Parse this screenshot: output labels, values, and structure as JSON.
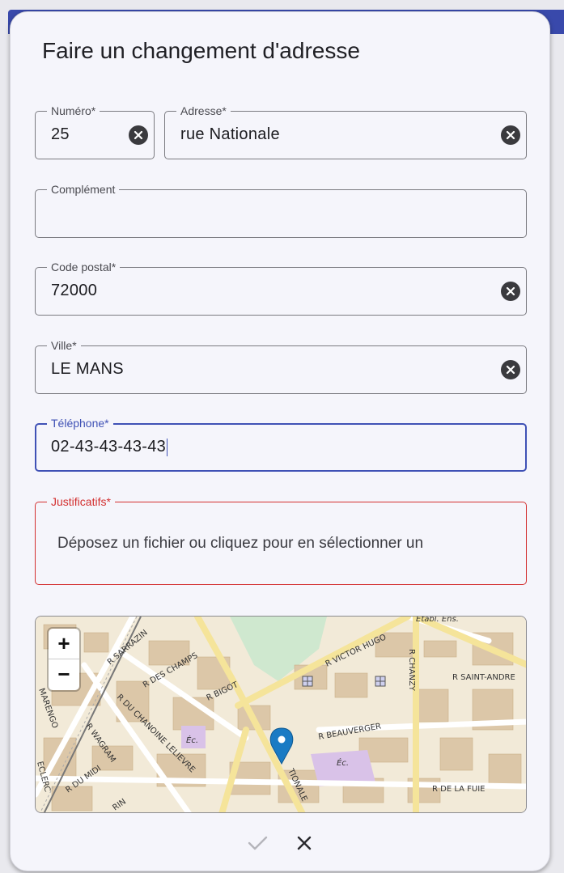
{
  "dialog": {
    "title": "Faire un changement d'adresse"
  },
  "form": {
    "numero": {
      "label": "Numéro*",
      "value": "25"
    },
    "adresse": {
      "label": "Adresse*",
      "value": "rue Nationale"
    },
    "complement": {
      "label": "Complément",
      "value": ""
    },
    "code_postal": {
      "label": "Code postal*",
      "value": "72000"
    },
    "ville": {
      "label": "Ville*",
      "value": "LE MANS"
    },
    "telephone": {
      "label": "Téléphone*",
      "value": "02-43-43-43-43"
    },
    "justificatifs": {
      "label": "Justificatifs*",
      "placeholder": "Déposez un fichier ou cliquez pour en sélectionner un"
    }
  },
  "map": {
    "zoom_in": "+",
    "zoom_out": "−",
    "street_labels": [
      "R SARRAZIN",
      "R DES CHAMPS",
      "R BIGOT",
      "R VICTOR HUGO",
      "R CHANZY",
      "R SAINT-ANDRE",
      "R BEAUVERGER",
      "R DE LA FUIE",
      "R DU MIDI",
      "R WAGRAM",
      "R DU CHANOINE LELIEVRE",
      "MARENGO",
      "ECLERC",
      "TIONALE",
      "Éc.",
      "Éc.",
      "Etabl. Ens.",
      "RIN"
    ]
  },
  "colors": {
    "primary": "#3f51b5",
    "error": "#d32f2f",
    "marker": "#1a7bc4"
  },
  "icons": {
    "clear": "clear-circle-icon",
    "confirm": "check-icon",
    "cancel": "close-icon",
    "marker": "map-marker-icon"
  }
}
